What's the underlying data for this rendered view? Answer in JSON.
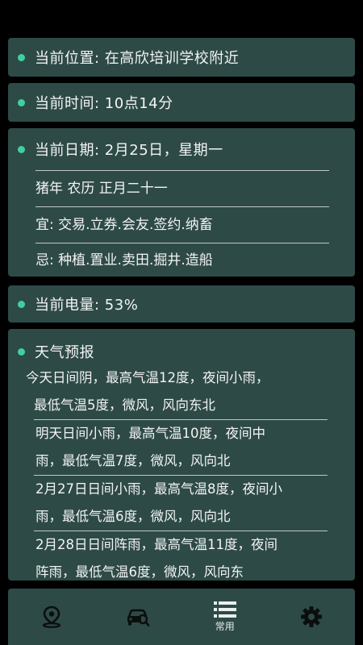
{
  "location": {
    "label": "当前位置",
    "value": "在高欣培训学校附近"
  },
  "time": {
    "label": "当前时间",
    "value": "10点14分"
  },
  "date": {
    "label": "当前日期",
    "value": "2月25日，星期一",
    "lunar": "猪年 农历 正月二十一",
    "yi": "宜: 交易.立券.会友.签约.纳畜",
    "ji": "忌: 种植.置业.卖田.掘井.造船"
  },
  "battery": {
    "label": "当前电量",
    "value": "53%"
  },
  "weather": {
    "title": "天气预报",
    "days": [
      {
        "line1": "今天日间阴，最高气温12度，夜间小雨，",
        "line2": "最低气温5度，微风，风向东北"
      },
      {
        "line1": "明天日间小雨，最高气温10度，夜间中",
        "line2": "雨，最低气温7度，微风，风向北"
      },
      {
        "line1": "2月27日日间小雨，最高气温8度，夜间小",
        "line2": "雨，最低气温6度，微风，风向北"
      },
      {
        "line1": "2月28日日间阵雨，最高气温11度，夜间",
        "line2": "阵雨，最低气温6度，微风，风向东"
      }
    ]
  },
  "nav": {
    "common_label": "常用"
  },
  "icons": {
    "location": "map-pin-icon",
    "car": "car-search-icon",
    "list": "list-icon",
    "settings": "gear-icon"
  },
  "colors": {
    "card": "#2e4a47",
    "dot": "#3fd09e",
    "background": "#000000"
  }
}
